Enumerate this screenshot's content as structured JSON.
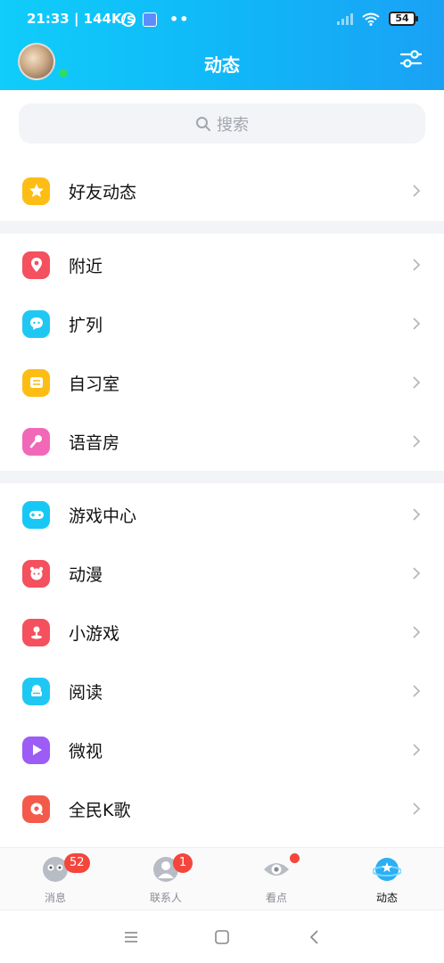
{
  "status_bar": {
    "time_and_speed": "21:33 | 144K/s",
    "battery": "54"
  },
  "header": {
    "title": "动态"
  },
  "search": {
    "placeholder": "搜索"
  },
  "groups": [
    {
      "items": [
        {
          "label": "好友动态",
          "icon": "star-icon",
          "color": "#fdbd15"
        }
      ]
    },
    {
      "items": [
        {
          "label": "附近",
          "icon": "location-pin-icon",
          "color": "#f4505e"
        },
        {
          "label": "扩列",
          "icon": "chat-add-icon",
          "color": "#1fc8f2"
        },
        {
          "label": "自习室",
          "icon": "book-icon",
          "color": "#fdbd15"
        },
        {
          "label": "语音房",
          "icon": "microphone-icon",
          "color": "#f268b8"
        }
      ]
    },
    {
      "items": [
        {
          "label": "游戏中心",
          "icon": "gamepad-icon",
          "color": "#18c8f4"
        },
        {
          "label": "动漫",
          "icon": "anime-face-icon",
          "color": "#f4505e"
        },
        {
          "label": "小游戏",
          "icon": "joystick-icon",
          "color": "#f4505e"
        },
        {
          "label": "阅读",
          "icon": "reading-icon",
          "color": "#1fc8f2"
        },
        {
          "label": "微视",
          "icon": "play-icon",
          "color": "#9c5cf5"
        },
        {
          "label": "全民K歌",
          "icon": "karaoke-icon",
          "color": "#f45a4a"
        }
      ]
    }
  ],
  "tabbar": {
    "tabs": [
      {
        "label": "消息",
        "icon": "message-icon",
        "badge": "52"
      },
      {
        "label": "联系人",
        "icon": "contacts-icon",
        "badge": "1"
      },
      {
        "label": "看点",
        "icon": "eye-icon",
        "badge": ""
      },
      {
        "label": "动态",
        "icon": "planet-star-icon",
        "badge": "",
        "active": true
      }
    ]
  },
  "colors": {
    "accent": "#10b8f8",
    "badge": "#f4463c"
  }
}
